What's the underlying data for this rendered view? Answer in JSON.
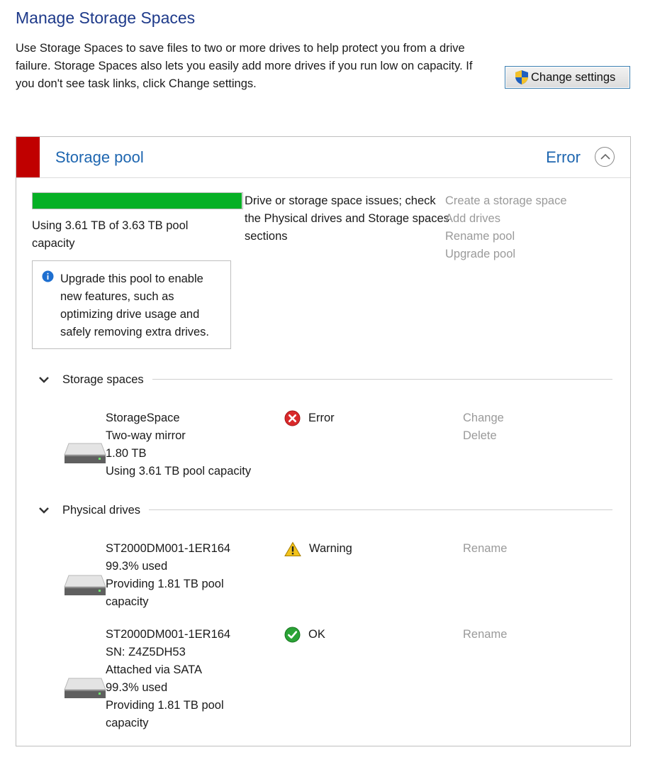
{
  "header": {
    "title": "Manage Storage Spaces",
    "intro": "Use Storage Spaces to save files to two or more drives to help protect you from a drive failure. Storage Spaces also lets you easily add more drives if you run low on capacity. If you don't see task links, click Change settings.",
    "change_settings_label": "Change settings"
  },
  "pool": {
    "title": "Storage pool",
    "status": "Error",
    "status_color": "#c00000",
    "usage_fraction": 0.995,
    "usage_text": "Using 3.61 TB of 3.63 TB pool capacity",
    "issue_text": "Drive or storage space issues; check the Physical drives and Storage spaces sections",
    "tasks": [
      "Create a storage space",
      "Add drives",
      "Rename pool",
      "Upgrade pool"
    ],
    "info_text": "Upgrade this pool to enable new features, such as optimizing drive usage and safely removing extra drives."
  },
  "storage_spaces": {
    "heading": "Storage spaces",
    "items": [
      {
        "name": "StorageSpace",
        "resiliency": "Two-way mirror",
        "size": "1.80 TB",
        "usage": "Using 3.61 TB pool capacity",
        "status": "Error",
        "status_icon": "error-icon",
        "actions": [
          "Change",
          "Delete"
        ]
      }
    ]
  },
  "physical_drives": {
    "heading": "Physical drives",
    "items": [
      {
        "lines": [
          "ST2000DM001-1ER164",
          "99.3% used",
          "Providing 1.81 TB pool capacity"
        ],
        "status": "Warning",
        "status_icon": "warning-icon",
        "action": "Rename"
      },
      {
        "lines": [
          "ST2000DM001-1ER164",
          "SN: Z4Z5DH53",
          "Attached via SATA",
          "99.3% used",
          "Providing 1.81 TB pool capacity"
        ],
        "status": "OK",
        "status_icon": "ok-icon",
        "action": "Rename"
      }
    ]
  }
}
